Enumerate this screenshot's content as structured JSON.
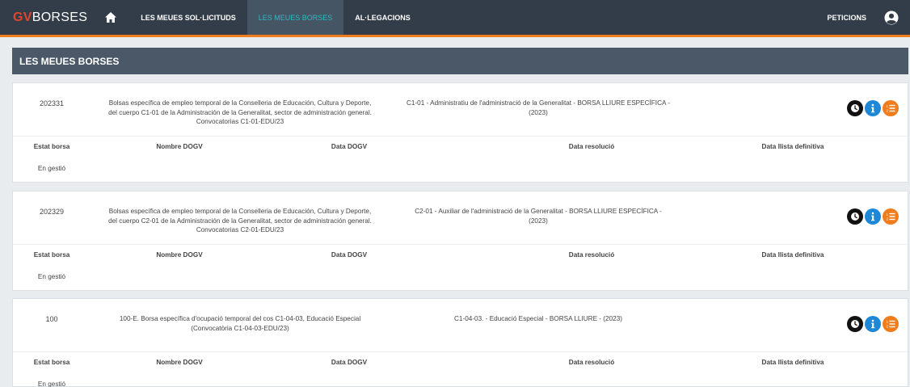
{
  "nav": {
    "brand_prefix": "GV",
    "brand_suffix": "BORSES",
    "items": [
      {
        "label": "LES MEUES SOL·LICITUDS"
      },
      {
        "label": "LES MEUES BORSES"
      },
      {
        "label": "AL·LEGACIONS"
      }
    ],
    "peticions": "PETICIONS",
    "active_color": "#2fb6c2",
    "accent_color": "#f07d1c"
  },
  "section": {
    "title": "LES MEUES BORSES"
  },
  "columns": {
    "estat": "Estat borsa",
    "nombre": "Nombre DOGV",
    "data": "Data DOGV",
    "resolucio": "Data resolució",
    "llista": "Data llista definitiva"
  },
  "borses": [
    {
      "code": "202331",
      "desc_lines": [
        "Bolsas específica de empleo temporal de la Conselleria de Educación, Cultura y Deporte,",
        "del cuerpo C1-01 de la Administración de la Generalitat, sector de administración general.",
        "Convocatorias C1-01-EDU/23"
      ],
      "title_lines": [
        "C1-01 - Administratiu de l'administració de la Generalitat - BORSA LLIURE ESPECÍFICA -",
        "(2023)"
      ],
      "estat": "En gestió",
      "nombre": "",
      "data": "",
      "resolucio": "",
      "llista": ""
    },
    {
      "code": "202329",
      "desc_lines": [
        "Bolsas específica de empleo temporal de la Conselleria de Educación, Cultura y Deporte,",
        "del cuerpo C2-01 de la Administración de la Generalitat, sector de administración general.",
        "Convocatorias C2-01-EDU/23"
      ],
      "title_lines": [
        "C2-01 - Auxiliar de l'administració de la Generalitat - BORSA LLIURE ESPECÍFICA -",
        "(2023)"
      ],
      "estat": "En gestió",
      "nombre": "",
      "data": "",
      "resolucio": "",
      "llista": ""
    },
    {
      "code": "100",
      "desc_lines": [
        "100-E. Borsa específica d'ocupació temporal del cos C1-04-03, Educació Especial",
        "(Convocatòria C1-04-03-EDU/23)"
      ],
      "title_lines": [
        "C1-04-03. - Educació Especial - BORSA LLIURE - (2023)"
      ],
      "estat": "En gestió",
      "nombre": "",
      "data": "",
      "resolucio": "",
      "llista": ""
    }
  ],
  "icons": [
    "home-icon",
    "user-circle-icon",
    "clock-icon",
    "info-icon",
    "list-icon"
  ]
}
